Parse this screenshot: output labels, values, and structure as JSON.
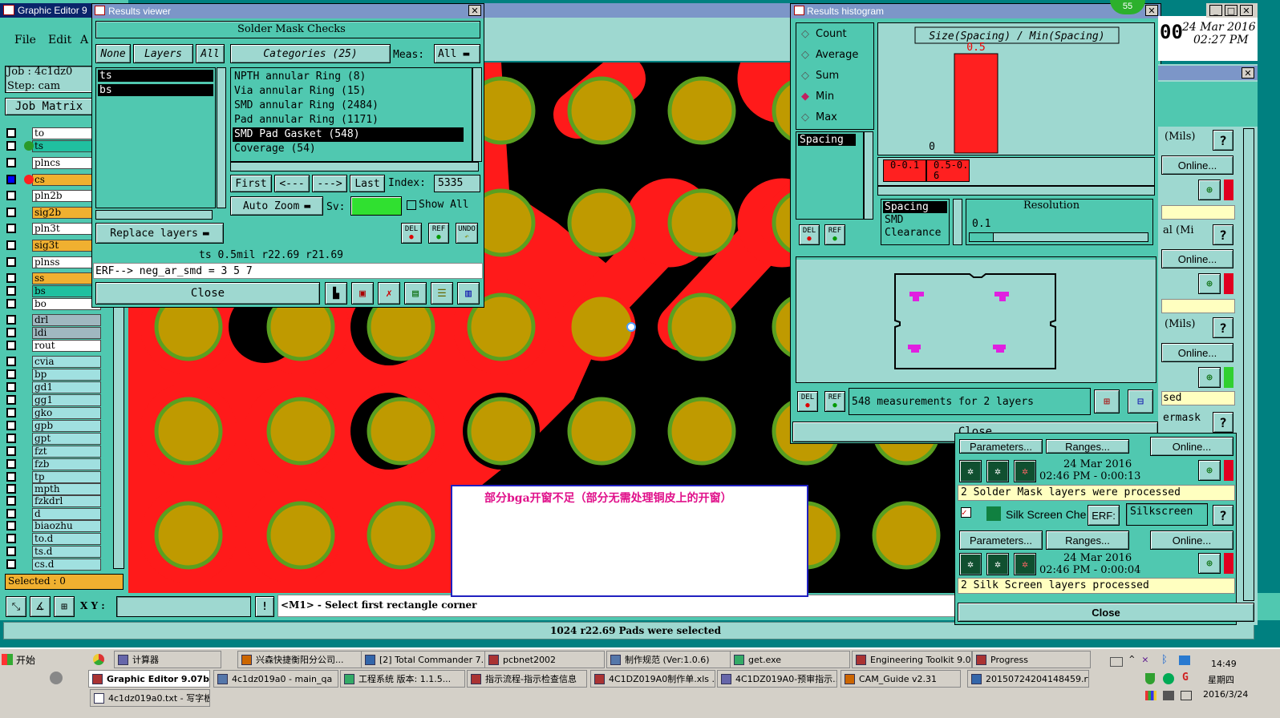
{
  "graphic_editor": {
    "title": "Graphic Editor 9",
    "menu": [
      "File",
      "Edit",
      "A"
    ],
    "job": "Job : 4c1dz0",
    "step": "Step: cam",
    "job_matrix": "Job Matrix",
    "selected": "Selected : 0",
    "layers": [
      {
        "name": "to",
        "color": "#ffffff"
      },
      {
        "name": "ts",
        "color": "#20c0a0"
      },
      {
        "name": "plncs",
        "color": "#ffffff"
      },
      {
        "name": "cs",
        "color": "#f0b030"
      },
      {
        "name": "pln2b",
        "color": "#ffffff"
      },
      {
        "name": "sig2b",
        "color": "#f0b030"
      },
      {
        "name": "pln3t",
        "color": "#ffffff"
      },
      {
        "name": "sig3t",
        "color": "#f0b030"
      },
      {
        "name": "plnss",
        "color": "#ffffff"
      },
      {
        "name": "ss",
        "color": "#f0b030"
      },
      {
        "name": "bs",
        "color": "#20c0a0"
      },
      {
        "name": "bo",
        "color": "#ffffff"
      },
      {
        "name": "drl",
        "color": "#a0b8c0"
      },
      {
        "name": "ldi",
        "color": "#a0b8c0"
      },
      {
        "name": "rout",
        "color": "#ffffff"
      },
      {
        "name": "cvia",
        "color": "#a0e0e0"
      },
      {
        "name": "bp",
        "color": "#a0e0e0"
      },
      {
        "name": "gd1",
        "color": "#a0e0e0"
      },
      {
        "name": "gg1",
        "color": "#a0e0e0"
      },
      {
        "name": "gko",
        "color": "#a0e0e0"
      },
      {
        "name": "gpb",
        "color": "#a0e0e0"
      },
      {
        "name": "gpt",
        "color": "#a0e0e0"
      },
      {
        "name": "fzt",
        "color": "#a0e0e0"
      },
      {
        "name": "fzb",
        "color": "#a0e0e0"
      },
      {
        "name": "tp",
        "color": "#a0e0e0"
      },
      {
        "name": "mpth",
        "color": "#a0e0e0"
      },
      {
        "name": "fzkdrl",
        "color": "#a0e0e0"
      },
      {
        "name": "d",
        "color": "#a0e0e0"
      },
      {
        "name": "biaozhu",
        "color": "#a0e0e0"
      },
      {
        "name": "to.d",
        "color": "#a0e0e0"
      },
      {
        "name": "ts.d",
        "color": "#a0e0e0"
      },
      {
        "name": "cs.d",
        "color": "#a0e0e0"
      }
    ],
    "xy_label": "X Y :",
    "status_prompt": "<M1> - Select first rectangle corner",
    "bottom_status": "1024 r22.69 Pads were selected"
  },
  "results_viewer": {
    "title": "Results viewer",
    "heading": "Solder Mask Checks",
    "none": "None",
    "layers_label": "Layers",
    "all": "All",
    "categories": "Categories (25)",
    "meas_label": "Meas:",
    "meas_value": "All",
    "layer_list": [
      "ts",
      "bs"
    ],
    "cat_list": [
      "NPTH annular Ring (8)",
      "Via annular Ring (15)",
      "SMD annular Ring (2484)",
      "Pad annular Ring (1171)",
      "SMD Pad Gasket (548)",
      "Coverage (54)"
    ],
    "first": "First",
    "prev": "<---",
    "next": "--->",
    "last": "Last",
    "index_label": "Index:",
    "index_value": "5335",
    "auto_zoom": "Auto Zoom",
    "sv": "Sv:",
    "show_all": "Show All",
    "replace_layers": "Replace layers",
    "del": "DEL",
    "ref": "REF",
    "undo": "UNDO",
    "info_line": "ts 0.5mil  r22.69  r21.69",
    "erf_line": "ERF--> neg_ar_smd = 3 5 7",
    "close": "Close"
  },
  "histogram": {
    "title": "Results histogram",
    "options": [
      "Count",
      "Average",
      "Sum",
      "Min",
      "Max"
    ],
    "selected_option": "Min",
    "chart_title": "Size(Spacing) / Min(Spacing)",
    "bar_label": "0.5",
    "zero_label": "0",
    "bins": [
      "0-0.1",
      "0.5-0.6"
    ],
    "list1": [
      "Spacing"
    ],
    "list2": [
      "Spacing",
      "SMD",
      "Clearance"
    ],
    "resolution_label": "Resolution",
    "resolution_value": "0.1",
    "measurements": "548 measurements for 2 layers",
    "close": "Close"
  },
  "chart_data": {
    "type": "bar",
    "title": "Size(Spacing) / Min(Spacing)",
    "categories": [
      "0-0.1",
      "0.5-0.6"
    ],
    "values": [
      0,
      0.5
    ],
    "value_labels": [
      "0",
      "0.5"
    ]
  },
  "clock": {
    "date": "24 Mar 2016",
    "time": "02:27 PM"
  },
  "note": {
    "text": "部分bga开窗不足（部分无需处理铜皮上的开窗）"
  },
  "checklist": {
    "mils1": "(Mils)",
    "online": "Online...",
    "mils2": "al (Mi",
    "mils3": "(Mils)",
    "sed": "sed",
    "ermask": "ermask",
    "params": "Parameters...",
    "ranges": "Ranges...",
    "help": "?",
    "run1": {
      "date": "24 Mar 2016",
      "time": "02:46 PM - 0:00:13",
      "result": "2 Solder Mask layers were processed"
    },
    "silk": {
      "name": "Silk Screen Che",
      "erf": "ERF:",
      "erf_value": "Silkscreen"
    },
    "run2": {
      "date": "24 Mar 2016",
      "time": "02:46 PM - 0:00:04",
      "result": "2 Silk Screen layers processed"
    },
    "close": "Close"
  },
  "badge": "55",
  "taskbar": {
    "start": "开始",
    "row1": [
      "计算器",
      "兴森快捷衡阳分公司...",
      "[2] Total Commander 7....",
      "pcbnet2002",
      "制作规范 (Ver:1.0.6)",
      "get.exe",
      "Engineering Toolkit 9.0....",
      "Progress"
    ],
    "row2": [
      "Graphic Editor 9.07b2...",
      "4c1dz019a0 - main_qa",
      "工程系统  版本: 1.1.5...",
      "指示流程-指示检查信息",
      "4C1DZ019A0制作单.xls ...",
      "4C1DZ019A0-预审指示...",
      "CAM_Guide v2.31",
      "20150724204148459.rtf..."
    ],
    "row3": [
      "4c1dz019a0.txt - 写字板"
    ],
    "time": "14:49",
    "weekday": "星期四",
    "date": "2016/3/24"
  },
  "colors": {
    "canvas_bg": "#000000",
    "copper": "#ff1a1a",
    "pad_fill": "#bf9a00",
    "pad_ring": "#5aa020",
    "panel": "#50c8b0",
    "panel_light": "#9ed8d0",
    "bar": "#ff2020"
  }
}
